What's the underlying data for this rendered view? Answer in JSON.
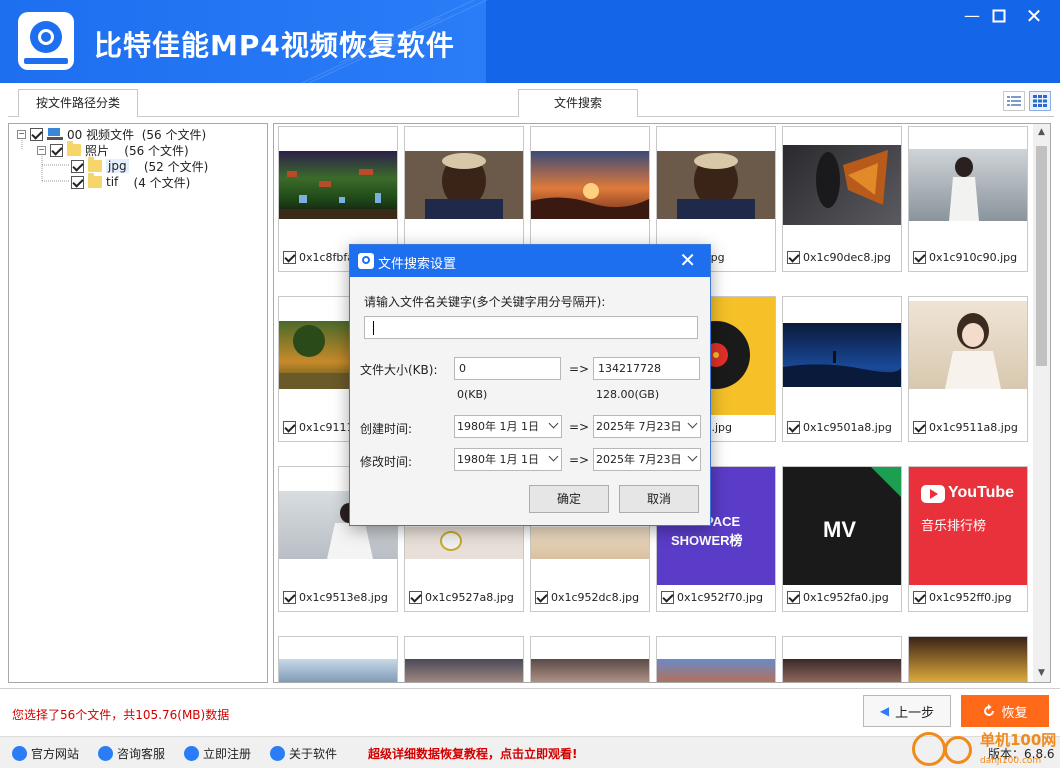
{
  "app": {
    "title": "比特佳能MP4视频恢复软件",
    "brand_color": "#1565e8",
    "window_controls": [
      "minimize-icon",
      "maximize-icon",
      "close-icon"
    ]
  },
  "tabs": {
    "path_category": "按文件路径分类",
    "file_search": "文件搜索"
  },
  "tree": [
    {
      "label": "00 视频文件",
      "count": "(56 个文件)"
    },
    {
      "label": "照片",
      "count": "(56 个文件)"
    },
    {
      "label": "jpg",
      "count": "(52 个文件)"
    },
    {
      "label": "tif",
      "count": "(4 个文件)"
    }
  ],
  "tiles": [
    {
      "name": "0x1c8fbfa",
      "checked": true
    },
    {
      "name": "",
      "checked": true
    },
    {
      "name": "",
      "checked": true
    },
    {
      "name": "dc18.jpg",
      "checked": true
    },
    {
      "name": "0x1c90dec8.jpg",
      "checked": true
    },
    {
      "name": "0x1c910c90.jpg",
      "checked": true
    },
    {
      "name": "0x1c9111",
      "checked": true
    },
    {
      "name": "",
      "checked": true
    },
    {
      "name": "",
      "checked": true
    },
    {
      "name": "2e0a8.jpg",
      "checked": true
    },
    {
      "name": "0x1c9501a8.jpg",
      "checked": true
    },
    {
      "name": "0x1c9511a8.jpg",
      "checked": true
    },
    {
      "name": "0x1c9513e8.jpg",
      "checked": true
    },
    {
      "name": "0x1c9527a8.jpg",
      "checked": true
    },
    {
      "name": "0x1c952dc8.jpg",
      "checked": true
    },
    {
      "name": "0x1c952f70.jpg",
      "checked": true
    },
    {
      "name": "0x1c952fa0.jpg",
      "checked": true
    },
    {
      "name": "0x1c952ff0.jpg",
      "checked": true
    }
  ],
  "thumb_text": {
    "space": "PACE",
    "shower": "SHOWER榜",
    "mv": "MV",
    "youtube": "YouTube",
    "youtube_sub": "音乐排行榜"
  },
  "dialog": {
    "title": "文件搜索设置",
    "keyword_label": "请输入文件名关键字(多个关键字用分号隔开):",
    "keyword_value": "",
    "size_label": "文件大小(KB):",
    "size_min": "0",
    "size_max": "134217728",
    "size_min_hint": "0(KB)",
    "size_max_hint": "128.00(GB)",
    "arrow": "=>",
    "created_label": "创建时间:",
    "created_from": "1980年  1月  1日",
    "created_to": "2025年  7月23日",
    "modified_label": "修改时间:",
    "modified_from": "1980年  1月  1日",
    "modified_to": "2025年  7月23日",
    "ok": "确定",
    "cancel": "取消"
  },
  "status": "您选择了56个文件，共105.76(MB)数据",
  "buttons": {
    "prev": "上一步",
    "recover": "恢复",
    "recover_color": "#ff6a1a"
  },
  "footer": {
    "links": [
      "官方网站",
      "咨询客服",
      "立即注册",
      "关于软件"
    ],
    "promo": "超级详细数据恢复教程，点击立即观看!",
    "version": "版本：6.8.6"
  },
  "watermark": {
    "text": "单机100网",
    "sub": "danji100.com"
  }
}
